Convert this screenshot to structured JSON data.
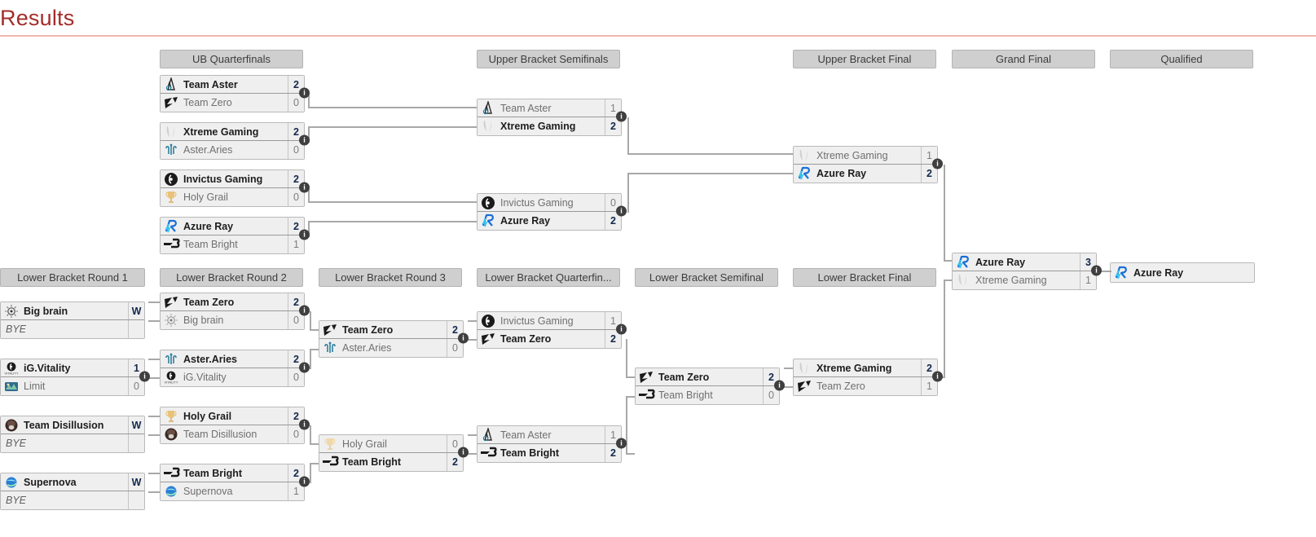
{
  "page": {
    "title": "Results",
    "accent_color": "#a32d2a",
    "rule_color": "#f0b4ae"
  },
  "legend": {
    "info_glyph": "i",
    "bye_label": "BYE",
    "walkover_label": "W"
  },
  "rounds": [
    {
      "id": "lbr1",
      "label": "Lower Bracket Round 1"
    },
    {
      "id": "ubqf",
      "label": "UB Quarterfinals"
    },
    {
      "id": "lbr2",
      "label": "Lower Bracket Round 2"
    },
    {
      "id": "lbr3",
      "label": "Lower Bracket Round 3"
    },
    {
      "id": "ubsf",
      "label": "Upper Bracket Semifinals"
    },
    {
      "id": "lbqf",
      "label": "Lower Bracket Quarterfin..."
    },
    {
      "id": "lbsf",
      "label": "Lower Bracket Semifinal"
    },
    {
      "id": "ubf",
      "label": "Upper Bracket Final"
    },
    {
      "id": "lbf",
      "label": "Lower Bracket Final"
    },
    {
      "id": "gf",
      "label": "Grand Final"
    },
    {
      "id": "qual",
      "label": "Qualified"
    }
  ],
  "matches": {
    "ubqf1": {
      "top": {
        "team": "Team Aster",
        "logo": "team-aster",
        "score": "2",
        "winner": true
      },
      "bottom": {
        "team": "Team Zero",
        "logo": "team-zero",
        "score": "0",
        "winner": false
      }
    },
    "ubqf2": {
      "top": {
        "team": "Xtreme Gaming",
        "logo": "xtreme-gaming",
        "score": "2",
        "winner": true
      },
      "bottom": {
        "team": "Aster.Aries",
        "logo": "aster-aries",
        "score": "0",
        "winner": false
      }
    },
    "ubqf3": {
      "top": {
        "team": "Invictus Gaming",
        "logo": "invictus-gaming",
        "score": "2",
        "winner": true
      },
      "bottom": {
        "team": "Holy Grail",
        "logo": "holy-grail",
        "score": "0",
        "winner": false
      }
    },
    "ubqf4": {
      "top": {
        "team": "Azure Ray",
        "logo": "azure-ray",
        "score": "2",
        "winner": true
      },
      "bottom": {
        "team": "Team Bright",
        "logo": "team-bright",
        "score": "1",
        "winner": false
      }
    },
    "ubsf1": {
      "top": {
        "team": "Team Aster",
        "logo": "team-aster",
        "score": "1",
        "winner": false
      },
      "bottom": {
        "team": "Xtreme Gaming",
        "logo": "xtreme-gaming",
        "score": "2",
        "winner": true
      }
    },
    "ubsf2": {
      "top": {
        "team": "Invictus Gaming",
        "logo": "invictus-gaming",
        "score": "0",
        "winner": false
      },
      "bottom": {
        "team": "Azure Ray",
        "logo": "azure-ray",
        "score": "2",
        "winner": true
      }
    },
    "ubf1": {
      "top": {
        "team": "Xtreme Gaming",
        "logo": "xtreme-gaming",
        "score": "1",
        "winner": false
      },
      "bottom": {
        "team": "Azure Ray",
        "logo": "azure-ray",
        "score": "2",
        "winner": true
      }
    },
    "gf1": {
      "top": {
        "team": "Azure Ray",
        "logo": "azure-ray",
        "score": "3",
        "winner": true
      },
      "bottom": {
        "team": "Xtreme Gaming",
        "logo": "xtreme-gaming",
        "score": "1",
        "winner": false
      }
    },
    "qual1": {
      "top": {
        "team": "Azure Ray",
        "logo": "azure-ray",
        "score": "",
        "winner": true
      }
    },
    "lbr1_1": {
      "top": {
        "team": "Big brain",
        "logo": "big-brain",
        "score": "W",
        "winner": true
      },
      "bottom": {
        "team": "BYE",
        "logo": "none",
        "score": "",
        "winner": false,
        "bye": true
      }
    },
    "lbr1_2": {
      "top": {
        "team": "iG.Vitality",
        "logo": "ig-vitality",
        "score": "1",
        "winner": true
      },
      "bottom": {
        "team": "Limit",
        "logo": "limit",
        "score": "0",
        "winner": false
      }
    },
    "lbr1_3": {
      "top": {
        "team": "Team Disillusion",
        "logo": "team-disillusion",
        "score": "W",
        "winner": true
      },
      "bottom": {
        "team": "BYE",
        "logo": "none",
        "score": "",
        "winner": false,
        "bye": true
      }
    },
    "lbr1_4": {
      "top": {
        "team": "Supernova",
        "logo": "supernova",
        "score": "W",
        "winner": true
      },
      "bottom": {
        "team": "BYE",
        "logo": "none",
        "score": "",
        "winner": false,
        "bye": true
      }
    },
    "lbr2_1": {
      "top": {
        "team": "Team Zero",
        "logo": "team-zero",
        "score": "2",
        "winner": true
      },
      "bottom": {
        "team": "Big brain",
        "logo": "big-brain",
        "score": "0",
        "winner": false
      }
    },
    "lbr2_2": {
      "top": {
        "team": "Aster.Aries",
        "logo": "aster-aries",
        "score": "2",
        "winner": true
      },
      "bottom": {
        "team": "iG.Vitality",
        "logo": "ig-vitality",
        "score": "0",
        "winner": false
      }
    },
    "lbr2_3": {
      "top": {
        "team": "Holy Grail",
        "logo": "holy-grail",
        "score": "2",
        "winner": true
      },
      "bottom": {
        "team": "Team Disillusion",
        "logo": "team-disillusion",
        "score": "0",
        "winner": false
      }
    },
    "lbr2_4": {
      "top": {
        "team": "Team Bright",
        "logo": "team-bright",
        "score": "2",
        "winner": true
      },
      "bottom": {
        "team": "Supernova",
        "logo": "supernova",
        "score": "1",
        "winner": false
      }
    },
    "lbr3_1": {
      "top": {
        "team": "Team Zero",
        "logo": "team-zero",
        "score": "2",
        "winner": true
      },
      "bottom": {
        "team": "Aster.Aries",
        "logo": "aster-aries",
        "score": "0",
        "winner": false
      }
    },
    "lbr3_2": {
      "top": {
        "team": "Holy Grail",
        "logo": "holy-grail",
        "score": "0",
        "winner": false
      },
      "bottom": {
        "team": "Team Bright",
        "logo": "team-bright",
        "score": "2",
        "winner": true
      }
    },
    "lbqf1": {
      "top": {
        "team": "Invictus Gaming",
        "logo": "invictus-gaming",
        "score": "1",
        "winner": false
      },
      "bottom": {
        "team": "Team Zero",
        "logo": "team-zero",
        "score": "2",
        "winner": true
      }
    },
    "lbqf2": {
      "top": {
        "team": "Team Aster",
        "logo": "team-aster",
        "score": "1",
        "winner": false
      },
      "bottom": {
        "team": "Team Bright",
        "logo": "team-bright",
        "score": "2",
        "winner": true
      }
    },
    "lbsf1": {
      "top": {
        "team": "Team Zero",
        "logo": "team-zero",
        "score": "2",
        "winner": true
      },
      "bottom": {
        "team": "Team Bright",
        "logo": "team-bright",
        "score": "0",
        "winner": false
      }
    },
    "lbf1": {
      "top": {
        "team": "Xtreme Gaming",
        "logo": "xtreme-gaming",
        "score": "2",
        "winner": true
      },
      "bottom": {
        "team": "Team Zero",
        "logo": "team-zero",
        "score": "1",
        "winner": false
      }
    }
  }
}
